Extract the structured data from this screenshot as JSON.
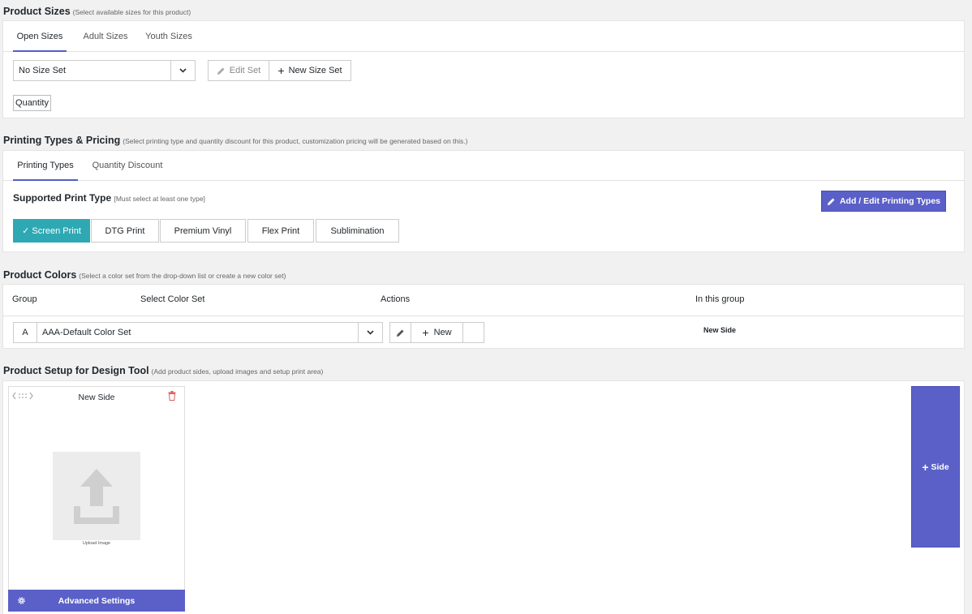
{
  "sizes": {
    "title": "Product Sizes",
    "hint": "(Select available sizes for this product)",
    "tabs": [
      "Open Sizes",
      "Adult Sizes",
      "Youth Sizes"
    ],
    "select_value": "No Size Set",
    "edit_set": "Edit Set",
    "new_size_set": "New Size Set",
    "quantity_tag": "Quantity"
  },
  "printing": {
    "title": "Printing Types & Pricing",
    "hint": "(Select printing type and quantity discount for this product, customization pricing will be generated based on this.)",
    "tabs": [
      "Printing Types",
      "Quantity Discount"
    ],
    "supported_label": "Supported Print Type",
    "supported_hint": "[Must select at least one type]",
    "add_edit_button": "Add / Edit Printing Types",
    "types": [
      "✓ Screen Print",
      "DTG Print",
      "Premium Vinyl",
      "Flex Print",
      "Sublimination"
    ],
    "accent_color": "#2ea9b3"
  },
  "colors": {
    "title": "Product Colors",
    "hint": "(Select a color set from the drop-down list or create a new color set)",
    "columns": [
      "Group",
      "Select Color Set",
      "Actions",
      "In this group"
    ],
    "row": {
      "group": "A",
      "color_set": "AAA-Default Color Set",
      "new_button": "New",
      "in_group": "New Side"
    }
  },
  "design": {
    "title": "Product Setup for Design Tool",
    "hint": "(Add product sides, upload images and setup print area)",
    "side_card": {
      "name": "New Side",
      "upload_label": "Upload Image",
      "advanced_settings": "Advanced Settings"
    },
    "add_side_button": "Side",
    "brand_color": "#5b60c8"
  }
}
